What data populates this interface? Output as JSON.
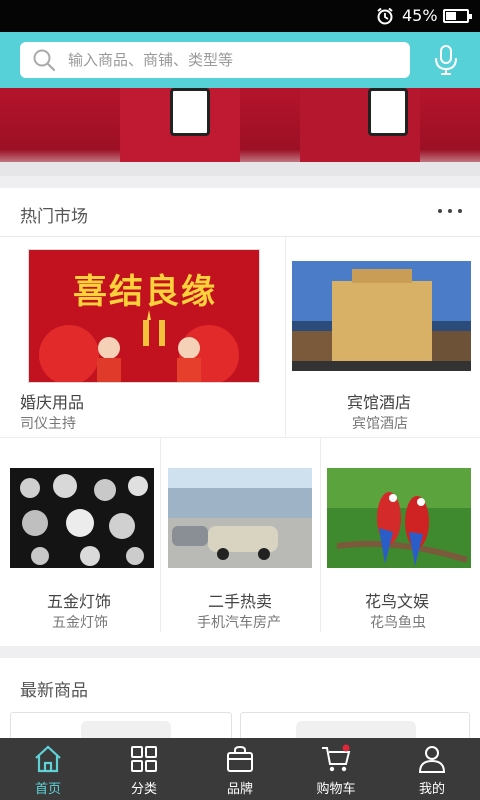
{
  "status_bar": {
    "battery_percent": "45%",
    "icons": [
      "alarm-icon",
      "battery-icon"
    ]
  },
  "search": {
    "placeholder": "输入商品、商铺、类型等",
    "icon": "search-icon",
    "voice_icon": "microphone-icon"
  },
  "colors": {
    "accent": "#57d1d8",
    "nav_background": "#3a3a3a",
    "nav_active": "#5fd2d8"
  },
  "hot_market": {
    "title": "热门市场",
    "more_icon": "more-icon",
    "items": [
      {
        "name": "婚庆用品",
        "sub": "司仪主持",
        "banner_text": "喜结良缘"
      },
      {
        "name": "宾馆酒店",
        "sub": "宾馆酒店"
      },
      {
        "name": "五金灯饰",
        "sub": "五金灯饰"
      },
      {
        "name": "二手热卖",
        "sub": "手机汽车房产"
      },
      {
        "name": "花鸟文娱",
        "sub": "花鸟鱼虫"
      }
    ]
  },
  "latest": {
    "title": "最新商品"
  },
  "bottom_nav": {
    "tabs": [
      {
        "label": "首页",
        "icon": "home-icon",
        "active": true
      },
      {
        "label": "分类",
        "icon": "category-grid-icon"
      },
      {
        "label": "品牌",
        "icon": "shopping-bag-icon"
      },
      {
        "label": "购物车",
        "icon": "cart-icon"
      },
      {
        "label": "我的",
        "icon": "user-icon"
      }
    ]
  }
}
